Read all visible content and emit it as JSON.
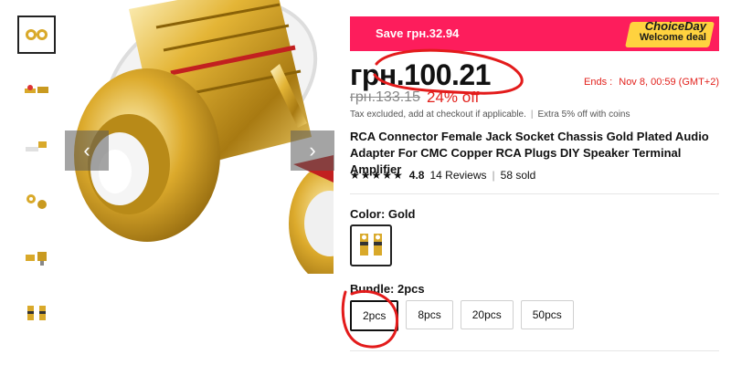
{
  "gallery": {
    "thumbnails": [
      "thumb-1",
      "thumb-2",
      "thumb-3",
      "thumb-4",
      "thumb-5",
      "thumb-6"
    ],
    "prev_icon": "‹",
    "next_icon": "›"
  },
  "promo": {
    "save_text": "Save грн.32.94",
    "badge_line1": "ChoiceDay",
    "badge_line2": "Welcome deal",
    "banner_color": "#fd1d5c",
    "badge_color": "#ffd23f"
  },
  "pricing": {
    "price": "грн.100.21",
    "ends_label": "Ends :",
    "ends_time": "Nov 8, 00:59 (GMT+2)",
    "old_price": "грн.133.15",
    "discount": "24% off",
    "tax_note": "Tax excluded, add at checkout if applicable.",
    "coins_note": "Extra 5% off with coins"
  },
  "product": {
    "title": "RCA Connector Female Jack Socket Chassis Gold Plated Audio Adapter For CMC Copper RCA Plugs DIY Speaker Terminal Amplifier",
    "stars": "★★★★★",
    "rating": "4.8",
    "reviews": "14 Reviews",
    "separator": "|",
    "sold": "58 sold"
  },
  "variants": {
    "color_label": "Color: Gold",
    "bundle_label": "Bundle: 2pcs",
    "bundle_options": [
      "2pcs",
      "8pcs",
      "20pcs",
      "50pcs"
    ],
    "selected_bundle": "2pcs"
  }
}
